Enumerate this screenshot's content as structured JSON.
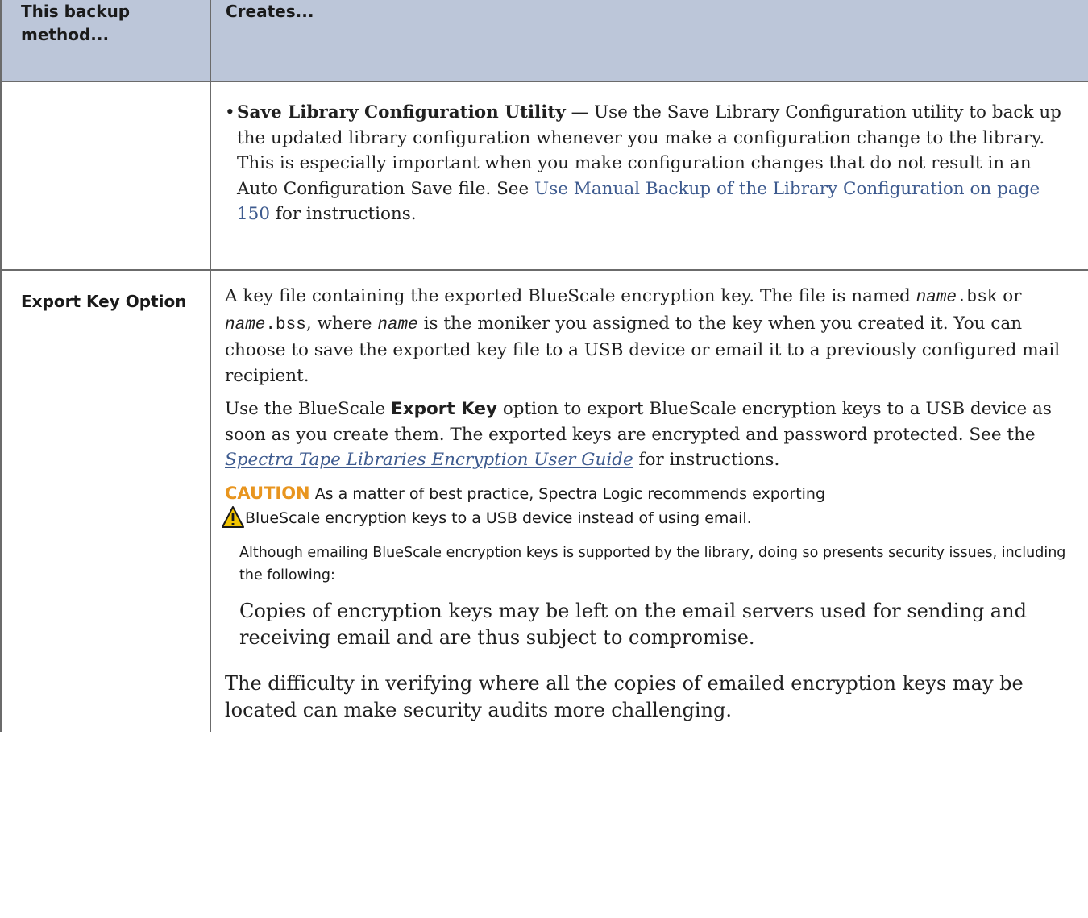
{
  "table": {
    "header": {
      "col1": "This backup method...",
      "col2": "Creates..."
    },
    "row1": {
      "bullet_title": "Save Library Configuration Utility",
      "bullet_dash": " — ",
      "bullet_text": "Use the Save Library Configuration utility to back up the updated library configuration whenever you make a configuration change to the library. This is especially important when you make configuration changes that do not result in an Auto Configuration Save file. See ",
      "bullet_link": "Use Manual Backup of the Library Configuration on page 150",
      "bullet_tail": " for instructions."
    },
    "row2": {
      "label": "Export Key Option",
      "para1": {
        "t1": "A key file containing the exported BlueScale encryption key. The file is named ",
        "code1_var": "name",
        "code1_ext": ".bsk",
        "t2": " or ",
        "code2_var": "name",
        "code2_ext": ".bss",
        "t3": ", where ",
        "code3_var": "name",
        "t4": " is the moniker you assigned to the key when you created it. You can choose to save the exported key file to a USB device or email it to a previously configured mail recipient."
      },
      "para2": {
        "t1": "Use the BlueScale ",
        "bold": "Export Key",
        "t2": " option to export BlueScale encryption keys to a USB device as soon as you create them. The exported keys are encrypted and password protected. See the ",
        "link": "Spectra Tape Libraries Encryption User Guide",
        "t3": " for instructions."
      },
      "caution": {
        "word": "CAUTION",
        "line1": "As a matter of best practice, Spectra Logic recommends exporting",
        "line2": "BlueScale encryption keys to a USB device instead of using email.",
        "sub": "Although emailing BlueScale encryption keys is supported by the library, doing so presents security issues, including the following:",
        "item": "Copies of encryption keys may be left on the email servers used for sending and receiving email and are thus subject to compromise."
      },
      "final": "The difficulty in verifying where all the copies of emailed encryption keys may be located can make security audits more challenging."
    }
  }
}
